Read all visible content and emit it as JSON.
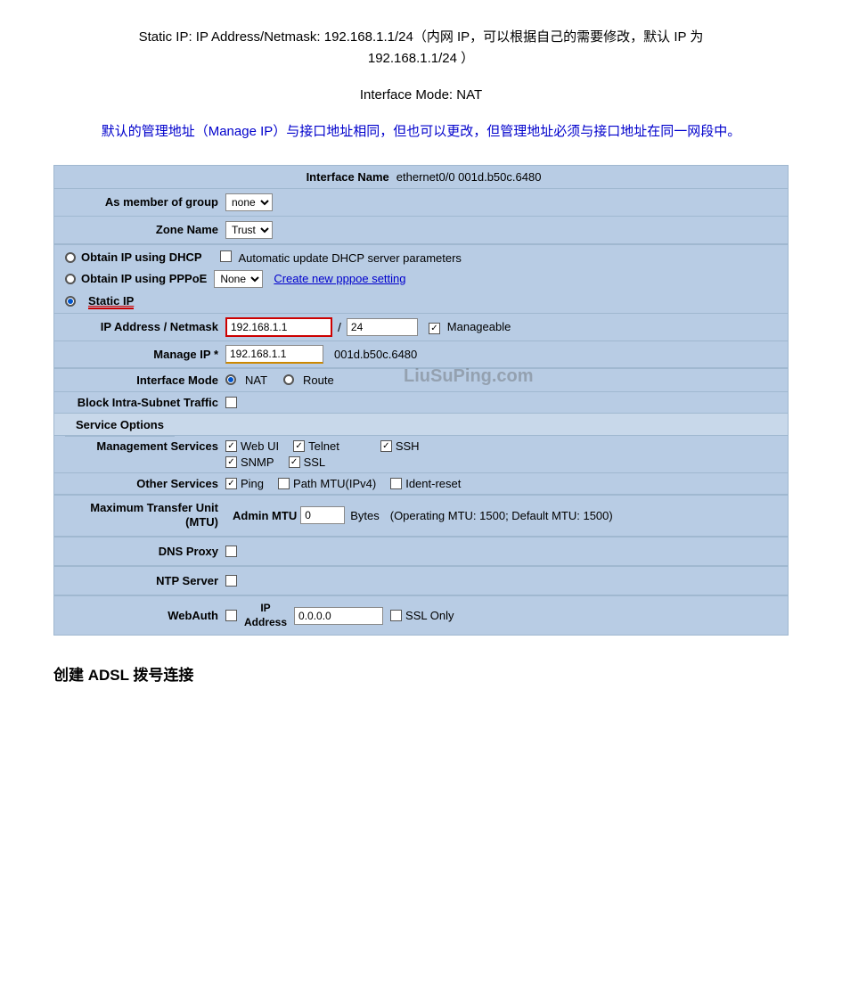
{
  "header": {
    "title_line1": "Static IP: IP Address/Netmask: 192.168.1.1/24（内网 IP，可以根据自己的需要修改，默认 IP 为",
    "title_line2": "192.168.1.1/24  ）"
  },
  "interface_mode_title": "Interface Mode: NAT",
  "manage_ip_note": "默认的管理地址（Manage IP）与接口地址相同，但也可以更改，但管理地址必须与接口地址在同一网段中。",
  "panel": {
    "interface_name_label": "Interface Name",
    "interface_name_value": "ethernet0/0  001d.b50c.6480",
    "as_member_label": "As member of group",
    "as_member_options": [
      "none"
    ],
    "zone_name_label": "Zone Name",
    "zone_name_options": [
      "Trust"
    ],
    "obtain_dhcp_label": "Obtain IP using DHCP",
    "auto_update_label": "Automatic update DHCP server parameters",
    "obtain_pppoe_label": "Obtain IP using PPPoE",
    "pppoe_options": [
      "None"
    ],
    "create_pppoe_link": "Create new pppoe setting",
    "static_ip_label": "Static IP",
    "ip_address_label": "IP Address / Netmask",
    "ip_address_value": "192.168.1.1",
    "netmask_value": "24",
    "manageable_label": "Manageable",
    "manage_ip_label": "Manage IP *",
    "manage_ip_value": "192.168.1.1",
    "manage_ip_suffix": "001d.b50c.6480",
    "interface_mode_label": "Interface Mode",
    "nat_label": "NAT",
    "route_label": "Route",
    "block_intra_label": "Block Intra-Subnet Traffic",
    "service_options_header": "Service Options",
    "management_services_label": "Management Services",
    "web_ui_label": "Web UI",
    "telnet_label": "Telnet",
    "ssh_label": "SSH",
    "snmp_label": "SNMP",
    "ssl_label": "SSL",
    "other_services_label": "Other Services",
    "ping_label": "Ping",
    "path_mtu_label": "Path MTU(IPv4)",
    "ident_reset_label": "Ident-reset",
    "mtu_label": "Maximum Transfer Unit\n(MTU)",
    "admin_mtu_label": "Admin MTU",
    "admin_mtu_value": "0",
    "bytes_label": "Bytes",
    "mtu_note": "(Operating MTU: 1500; Default MTU: 1500)",
    "dns_proxy_label": "DNS Proxy",
    "ntp_server_label": "NTP Server",
    "webauth_label": "WebAuth",
    "ip_address_label2": "IP\nAddress",
    "webauth_ip_value": "0.0.0.0",
    "ssl_only_label": "SSL Only",
    "watermark": "LiuSuPing.com"
  },
  "footer": {
    "adsl_title": "创建 ADSL 拨号连接"
  }
}
